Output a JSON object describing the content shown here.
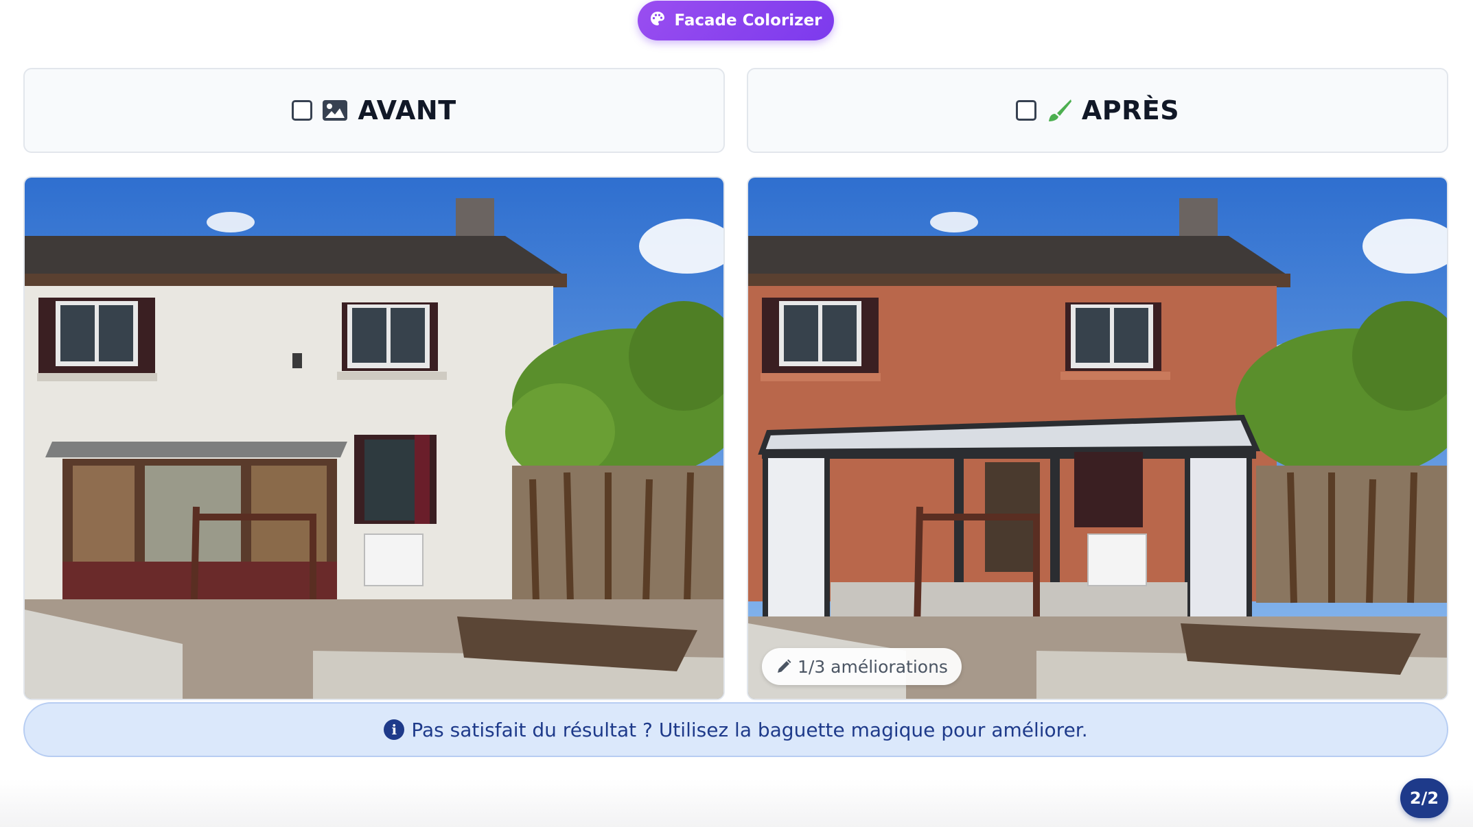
{
  "app": {
    "title": "Facade Colorizer",
    "icon": "palette-icon"
  },
  "panels": {
    "before": {
      "title": "AVANT",
      "icon": "image-icon",
      "checked": false
    },
    "after": {
      "title": "APRÈS",
      "icon": "paintbrush-icon",
      "checked": false
    }
  },
  "after_photo": {
    "improvements_badge": "1/3 améliorations",
    "badge_icon": "pencil-icon"
  },
  "info": {
    "icon": "info-icon",
    "message": "Pas satisfait du résultat ? Utilisez la baguette magique pour améliorer."
  },
  "pagination": {
    "label": "2/2"
  },
  "colors": {
    "accent_purple": "#7c3aed",
    "navy": "#1e3a8a",
    "after_facade": "#b9674b",
    "before_facade": "#e9e7e1",
    "brush_green": "#4caf50"
  }
}
